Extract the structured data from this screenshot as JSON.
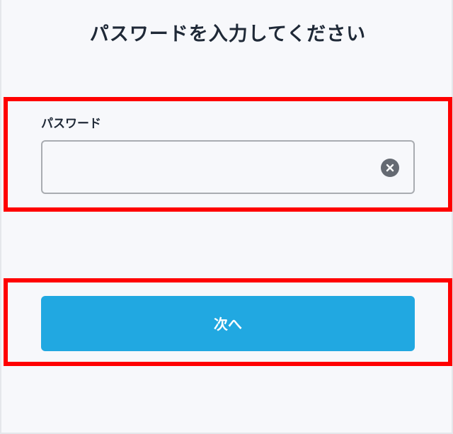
{
  "page": {
    "title": "パスワードを入力してください"
  },
  "password_field": {
    "label": "パスワード",
    "value": "",
    "placeholder": "",
    "clear_icon": "close-circle-icon"
  },
  "actions": {
    "next_label": "次へ"
  },
  "colors": {
    "accent": "#21a8e1",
    "highlight": "#ff0000",
    "text": "#1f2937",
    "clear_icon_bg": "#656a72"
  }
}
